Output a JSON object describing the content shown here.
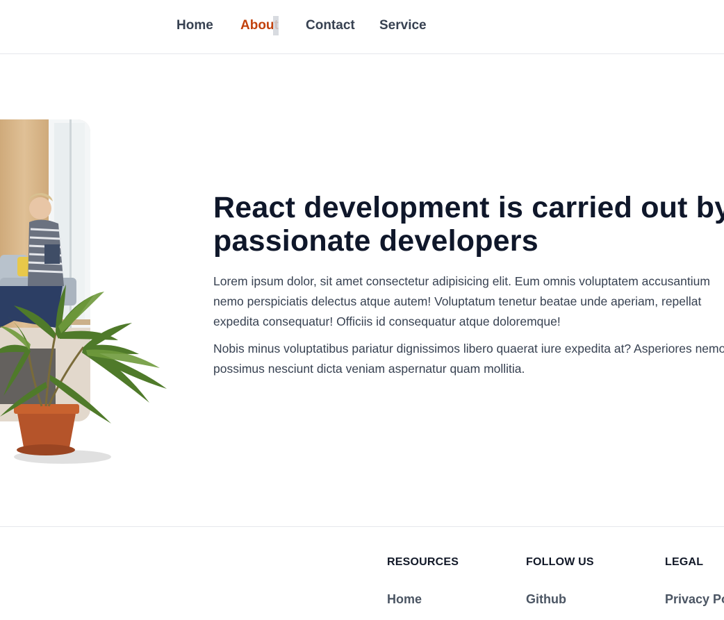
{
  "nav": {
    "items": [
      {
        "label": "Home",
        "active": false
      },
      {
        "label": "About",
        "active": true
      },
      {
        "label": "Contact",
        "active": false
      },
      {
        "label": "Service",
        "active": false
      }
    ]
  },
  "hero": {
    "title": "React development is carried out by passionate developers",
    "paragraphs": [
      "Lorem ipsum dolor, sit amet consectetur adipisicing elit. Eum omnis voluptatem accusantium nemo perspiciatis delectus atque autem! Voluptatum tenetur beatae unde aperiam, repellat expedita consequatur! Officiis id consequatur atque doloremque!",
      "Nobis minus voluptatibus pariatur dignissimos libero quaerat iure expedita at? Asperiores nemo possimus nesciunt dicta veniam aspernatur quam mollitia."
    ]
  },
  "footer": {
    "columns": [
      {
        "title": "RESOURCES",
        "links": [
          "Home"
        ]
      },
      {
        "title": "FOLLOW US",
        "links": [
          "Github"
        ]
      },
      {
        "title": "LEGAL",
        "links": [
          "Privacy Po"
        ]
      }
    ]
  },
  "colors": {
    "accent": "#c2410c",
    "nav_text": "#374151",
    "heading": "#0f172a",
    "body_text": "#374151",
    "border": "#e5e7eb"
  }
}
